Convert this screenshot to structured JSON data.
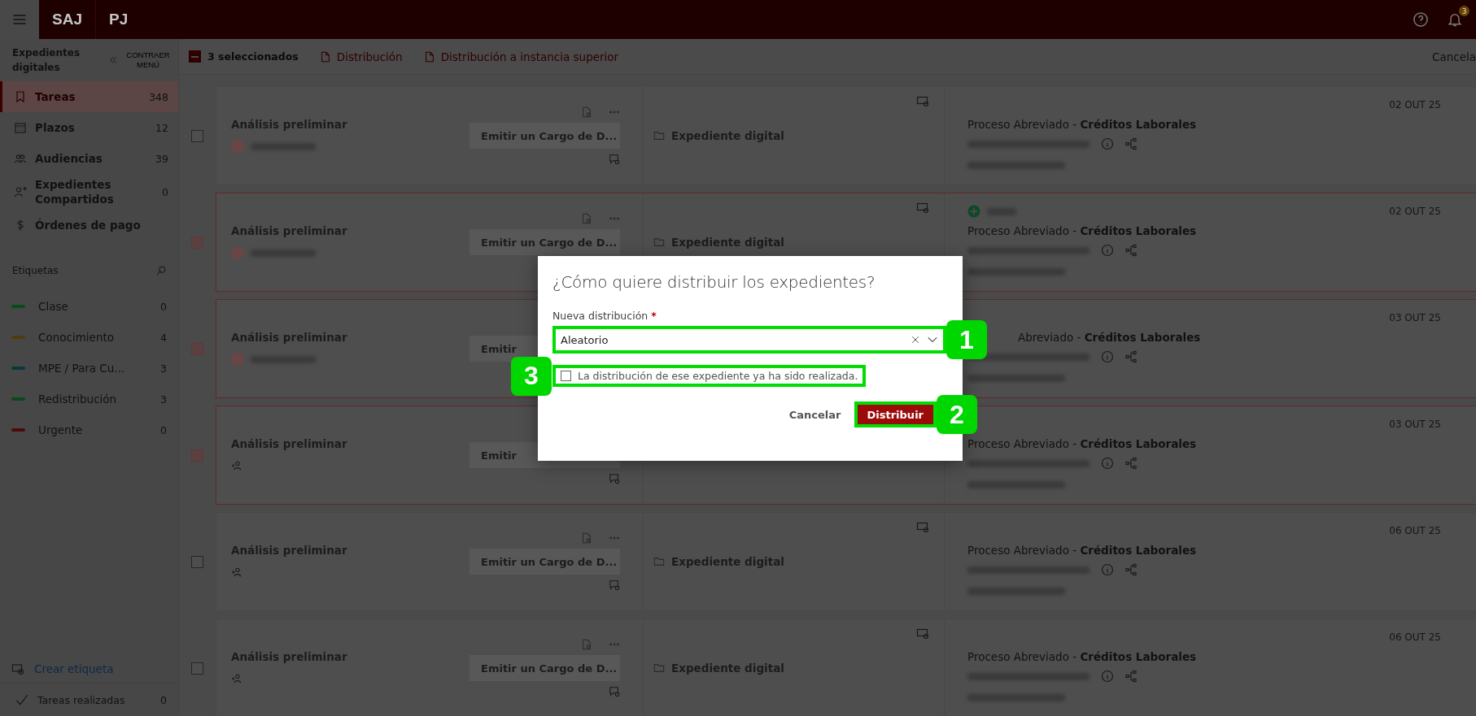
{
  "top_bar": {
    "logo": "SAJ",
    "secondary": "PJ",
    "notification_count": "3"
  },
  "sidebar": {
    "title": "Expedientes digitales",
    "collapse_label": "CONTRAER MENÚ",
    "nav": [
      {
        "label": "Tareas",
        "count": "348",
        "selected": true
      },
      {
        "label": "Plazos",
        "count": "12",
        "selected": false
      },
      {
        "label": "Audiencias",
        "count": "39",
        "selected": false
      },
      {
        "label": "Expedientes Compartidos",
        "count": "0",
        "selected": false
      },
      {
        "label": "Órdenes de pago",
        "selected": false
      }
    ],
    "tags_title": "Etiquetas",
    "tags": [
      {
        "label": "Clase",
        "count": "0",
        "color": "#0a4a1c"
      },
      {
        "label": "Conocimiento",
        "count": "4",
        "color": "#4e3c08"
      },
      {
        "label": "MPE / Para Cu...",
        "count": "3",
        "color": "#08383e"
      },
      {
        "label": "Redistribución",
        "count": "3",
        "color": "#0a4a1c"
      },
      {
        "label": "Urgente",
        "count": "0",
        "color": "#4e0a0a"
      }
    ],
    "create_tag": "Crear etiqueta",
    "done": {
      "label": "Tareas realizadas",
      "count": "0"
    }
  },
  "toolbar": {
    "indeterminate": true,
    "selection": "3 seleccionados",
    "actions": [
      "Distribución",
      "Distribución a instancia superior"
    ],
    "cancel": "Cancela"
  },
  "rows": [
    {
      "selected": false,
      "kind": "assigned",
      "title": "Análisis preliminar",
      "action": "Emitir un Cargo de D...",
      "expediente": "Expediente digital",
      "marked": false,
      "clipped": false,
      "process": "Proceso Abreviado - **Créditos Laborales**",
      "date": "02 OUT 25"
    },
    {
      "selected": true,
      "kind": "assigned",
      "title": "Análisis preliminar",
      "action": "Emitir un Cargo de D...",
      "expediente": "Expediente digital",
      "marked": true,
      "clipped": false,
      "process": "Proceso Abreviado - **Créditos Laborales**",
      "date": "02 OUT 25"
    },
    {
      "selected": true,
      "kind": "assigned",
      "title": "Análisis preliminar",
      "action": "Emitir",
      "marked": false,
      "clipped": true,
      "process": "Abreviado - **Créditos Laborales**",
      "date": "03 OUT 25"
    },
    {
      "selected": true,
      "kind": "unassigned",
      "title": "Análisis preliminar",
      "action": "Emitir",
      "marked": false,
      "clipped": false,
      "process": "Proceso Abreviado - **Créditos Laborales**",
      "date": "03 OUT 25"
    },
    {
      "selected": false,
      "kind": "unassigned",
      "title": "Análisis preliminar",
      "action": "Emitir un Cargo de D...",
      "expediente": "Expediente digital",
      "marked": false,
      "clipped": false,
      "process": "Proceso Abreviado - **Créditos Laborales**",
      "date": "06 OUT 25"
    },
    {
      "selected": false,
      "kind": "unassigned",
      "title": "Análisis preliminar",
      "action": "Emitir un Cargo de D...",
      "expediente": "Expediente digital",
      "marked": false,
      "clipped": false,
      "process": "Proceso Abreviado - **Créditos Laborales**",
      "date": "06 OUT 25"
    }
  ],
  "dialog": {
    "title": "¿Cómo quiere distribuir los expedientes?",
    "field": {
      "label": "Nueva distribución",
      "required_mark": "*",
      "value": "Aleatorio",
      "callout": "1"
    },
    "checkbox": {
      "label": "La distribución de ese expediente ya ha sido realizada.",
      "checked": false,
      "callout": "3"
    },
    "cancel": "Cancelar",
    "primary": {
      "label": "Distribuir",
      "callout": "2"
    }
  }
}
